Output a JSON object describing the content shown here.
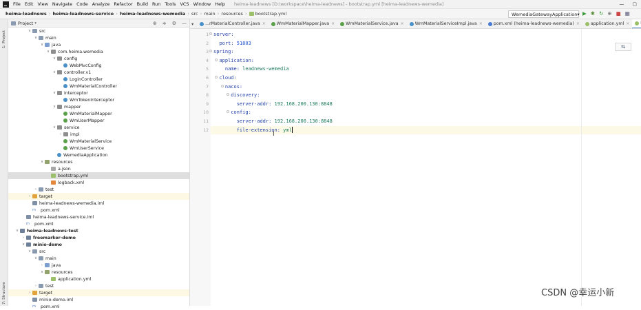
{
  "titlebar": {
    "menus": [
      "File",
      "Edit",
      "View",
      "Navigate",
      "Code",
      "Analyze",
      "Refactor",
      "Build",
      "Run",
      "Tools",
      "VCS",
      "Window",
      "Help"
    ],
    "title": "heima-leadnews [D:\\workspace\\heima-leadnews] - bootstrap.yml [heima-leadnews-wemedia]",
    "controls": [
      "—",
      "▢"
    ]
  },
  "breadcrumbs": [
    "heima-leadnews",
    "heima-leadnews-service",
    "heima-leadnews-wemedia",
    "src",
    "main",
    "resources",
    "bootstrap.yml"
  ],
  "run_config": "WemediaGatewayApplication",
  "toolbar_icons": [
    "▶",
    "✱",
    "↻",
    "⊕",
    "■",
    "▦"
  ],
  "left_tabs": [
    "1: Project",
    "7: Structure"
  ],
  "project_panel": {
    "title": "Project",
    "tools": [
      "⊕",
      "≑",
      "⚙",
      "—"
    ]
  },
  "tree": [
    {
      "indent": 1,
      "arrow": "open",
      "icon": "folder",
      "label": "src"
    },
    {
      "indent": 2,
      "arrow": "open",
      "icon": "folder",
      "label": "main"
    },
    {
      "indent": 3,
      "arrow": "open",
      "icon": "srcf",
      "label": "java"
    },
    {
      "indent": 4,
      "arrow": "open",
      "icon": "pkg",
      "label": "com.heima.wemedia"
    },
    {
      "indent": 5,
      "arrow": "open",
      "icon": "pkg",
      "label": "config"
    },
    {
      "indent": 6,
      "arrow": "",
      "icon": "cls",
      "label": "WebMvcConfig"
    },
    {
      "indent": 5,
      "arrow": "open",
      "icon": "pkg",
      "label": "controller.v1"
    },
    {
      "indent": 6,
      "arrow": "",
      "icon": "cls",
      "label": "LoginController"
    },
    {
      "indent": 6,
      "arrow": "",
      "icon": "cls",
      "label": "WmMaterialController"
    },
    {
      "indent": 5,
      "arrow": "open",
      "icon": "pkg",
      "label": "interceptor"
    },
    {
      "indent": 6,
      "arrow": "",
      "icon": "cls",
      "label": "WmTokenInterceptor"
    },
    {
      "indent": 5,
      "arrow": "open",
      "icon": "pkg",
      "label": "mapper"
    },
    {
      "indent": 6,
      "arrow": "",
      "icon": "iface",
      "label": "WmMaterialMapper"
    },
    {
      "indent": 6,
      "arrow": "",
      "icon": "iface",
      "label": "WmUserMapper"
    },
    {
      "indent": 5,
      "arrow": "open",
      "icon": "pkg",
      "label": "service"
    },
    {
      "indent": 6,
      "arrow": "closed",
      "icon": "pkg",
      "label": "impl"
    },
    {
      "indent": 6,
      "arrow": "",
      "icon": "iface",
      "label": "WmMaterialService"
    },
    {
      "indent": 6,
      "arrow": "",
      "icon": "iface",
      "label": "WmUserService"
    },
    {
      "indent": 5,
      "arrow": "",
      "icon": "cls",
      "label": "WemediaApplication"
    },
    {
      "indent": 3,
      "arrow": "open",
      "icon": "resf",
      "label": "resources"
    },
    {
      "indent": 4,
      "arrow": "",
      "icon": "json",
      "label": "a.json"
    },
    {
      "indent": 4,
      "arrow": "",
      "icon": "yml",
      "label": "bootstrap.yml",
      "state": "sel"
    },
    {
      "indent": 4,
      "arrow": "",
      "icon": "xml",
      "label": "logback.xml"
    },
    {
      "indent": 2,
      "arrow": "closed",
      "icon": "folder",
      "label": "test"
    },
    {
      "indent": 1,
      "arrow": "closed",
      "icon": "target",
      "label": "target",
      "state": "ylw"
    },
    {
      "indent": 1,
      "arrow": "",
      "icon": "iml",
      "label": "heima-leadnews-wemedia.iml"
    },
    {
      "indent": 1,
      "arrow": "",
      "icon": "mvn",
      "label": "pom.xml"
    },
    {
      "indent": 0,
      "arrow": "",
      "icon": "iml",
      "label": "heima-leadnews-service.iml"
    },
    {
      "indent": 0,
      "arrow": "",
      "icon": "mvn",
      "label": "pom.xml"
    },
    {
      "indent": -1,
      "arrow": "open",
      "icon": "mod",
      "label": "heima-leadnews-test",
      "bold": true
    },
    {
      "indent": 0,
      "arrow": "closed",
      "icon": "mod",
      "label": "freemarker-demo",
      "bold": true
    },
    {
      "indent": 0,
      "arrow": "open",
      "icon": "mod",
      "label": "minio-demo",
      "bold": true
    },
    {
      "indent": 1,
      "arrow": "open",
      "icon": "folder",
      "label": "src"
    },
    {
      "indent": 2,
      "arrow": "open",
      "icon": "folder",
      "label": "main"
    },
    {
      "indent": 3,
      "arrow": "closed",
      "icon": "srcf",
      "label": "java"
    },
    {
      "indent": 3,
      "arrow": "open",
      "icon": "resf",
      "label": "resources"
    },
    {
      "indent": 4,
      "arrow": "",
      "icon": "yml",
      "label": "application.yml"
    },
    {
      "indent": 2,
      "arrow": "closed",
      "icon": "folder",
      "label": "test"
    },
    {
      "indent": 1,
      "arrow": "closed",
      "icon": "target",
      "label": "target",
      "state": "ylw"
    },
    {
      "indent": 1,
      "arrow": "",
      "icon": "iml",
      "label": "minio-demo.iml"
    },
    {
      "indent": 1,
      "arrow": "",
      "icon": "mvn",
      "label": "pom.xml"
    }
  ],
  "editor_tabs": [
    {
      "label": "...rMaterialController.java",
      "icon": "#4a90c8"
    },
    {
      "label": "WmMaterialMapper.java",
      "icon": "#5aa04a"
    },
    {
      "label": "WmMaterialService.java",
      "icon": "#5aa04a"
    },
    {
      "label": "WmMaterialServiceImpl.java",
      "icon": "#4a90c8"
    },
    {
      "label": "pom.xml (heima-leadnews-wemedia)",
      "icon": "#4a7bd0"
    },
    {
      "label": "application.yml",
      "icon": "#9cbf6a"
    },
    {
      "label": "bootstrap.yml",
      "icon": "#9cbf6a",
      "active": true
    }
  ],
  "tab_menu": "▾",
  "code_lines": [
    {
      "n": "1",
      "indent": "",
      "key": "server:",
      "val": ""
    },
    {
      "n": "2",
      "indent": "  ",
      "key": "port:",
      "val": " 51803",
      "num": true
    },
    {
      "n": "3",
      "indent": "",
      "key": "spring:",
      "val": ""
    },
    {
      "n": "4",
      "indent": "  ",
      "key": "application:",
      "val": ""
    },
    {
      "n": "5",
      "indent": "    ",
      "key": "name:",
      "val": " leadnews-wemedia"
    },
    {
      "n": "6",
      "indent": "  ",
      "key": "cloud:",
      "val": ""
    },
    {
      "n": "7",
      "indent": "    ",
      "key": "nacos:",
      "val": ""
    },
    {
      "n": "8",
      "indent": "      ",
      "key": "discovery:",
      "val": ""
    },
    {
      "n": "9",
      "indent": "        ",
      "key": "server-addr:",
      "val": " 192.168.200.130:8848"
    },
    {
      "n": "10",
      "indent": "      ",
      "key": "config:",
      "val": ""
    },
    {
      "n": "11",
      "indent": "        ",
      "key": "server-addr:",
      "val": " 192.168.200.130:8848"
    },
    {
      "n": "12",
      "indent": "        ",
      "key": "file-extension:",
      "val": " yml",
      "cursor": true
    }
  ],
  "editor_button": "⇆",
  "watermark": "CSDN @幸运小新"
}
